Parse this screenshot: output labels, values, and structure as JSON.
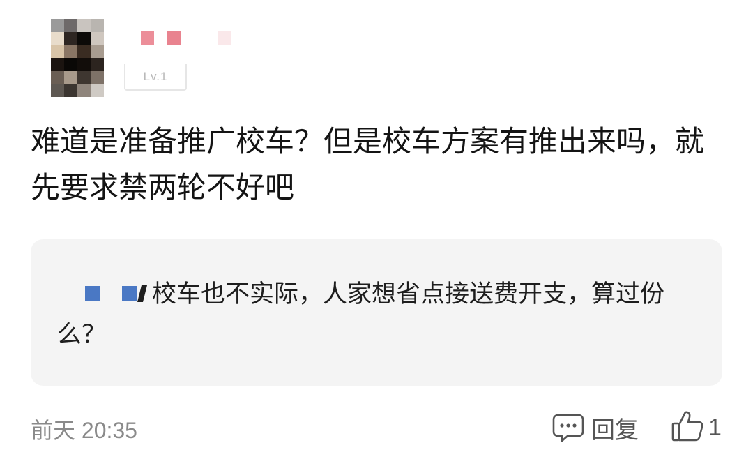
{
  "comment": {
    "author": {
      "level": "Lv.1"
    },
    "text": "难道是准备推广校车？但是校车方案有推出来吗，就先要求禁两轮不好吧",
    "quoted_reply": {
      "text": "校车也不实际，人家想省点接送费开支，算过份么？"
    },
    "time": "前天 20:35",
    "reply_label": "回复",
    "like_count": "1"
  },
  "colors": {
    "background": "#ffffff",
    "quote_background": "#f4f4f4",
    "quote_username_mosaic": "#4a78c4",
    "username_mosaic": "#ee8c98",
    "meta_text": "#8a8a8a"
  },
  "icons": {
    "reply": "comment-bubble-icon",
    "like": "thumbs-up-icon"
  }
}
